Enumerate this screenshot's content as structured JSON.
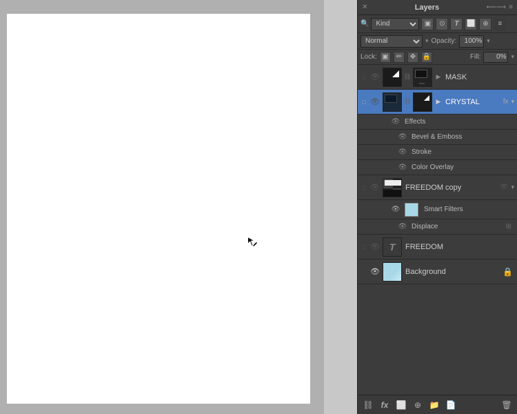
{
  "panel": {
    "title": "Layers",
    "close_icon": "✕",
    "menu_icon": "≡",
    "filter_label": "Kind",
    "blend_mode": "Normal",
    "opacity_label": "Opacity:",
    "opacity_value": "100%",
    "lock_label": "Lock:",
    "fill_label": "Fill:",
    "fill_value": "0%"
  },
  "layers": [
    {
      "id": "mask-layer",
      "name": "MASK",
      "type": "normal",
      "thumb": "black-white",
      "visible": false,
      "selected": false,
      "has_mask": true,
      "fx": false
    },
    {
      "id": "crystal-layer",
      "name": "CRYSTAL",
      "type": "normal",
      "thumb": "monitor",
      "visible": false,
      "selected": true,
      "has_mask": true,
      "fx": true,
      "effects": [
        {
          "name": "Effects",
          "is_header": true
        },
        {
          "name": "Bevel & Emboss",
          "is_header": false
        },
        {
          "name": "Stroke",
          "is_header": false
        },
        {
          "name": "Color Overlay",
          "is_header": false
        }
      ]
    },
    {
      "id": "freedom-copy-layer",
      "name": "FREEDOM copy",
      "type": "normal",
      "thumb": "checkerboard",
      "visible": false,
      "selected": false,
      "has_mask": false,
      "fx": false,
      "smart_filter": true,
      "sub_items": [
        {
          "name": "Smart Filters",
          "thumb": "light-blue"
        },
        {
          "name": "Displace",
          "has_settings": true
        }
      ]
    },
    {
      "id": "freedom-layer",
      "name": "FREEDOM",
      "type": "text",
      "thumb": "none",
      "visible": false,
      "selected": false,
      "has_mask": false,
      "fx": false
    },
    {
      "id": "background-layer",
      "name": "Background",
      "type": "normal",
      "thumb": "light-blue",
      "visible": true,
      "selected": false,
      "has_mask": false,
      "fx": false,
      "locked": true
    }
  ],
  "bottom_toolbar": {
    "link_tooltip": "Link layers",
    "fx_tooltip": "Add layer style",
    "mask_tooltip": "Add layer mask",
    "adjustment_tooltip": "New fill or adjustment layer",
    "group_tooltip": "Create a new group",
    "new_layer_tooltip": "Create a new layer",
    "delete_tooltip": "Delete layer"
  }
}
